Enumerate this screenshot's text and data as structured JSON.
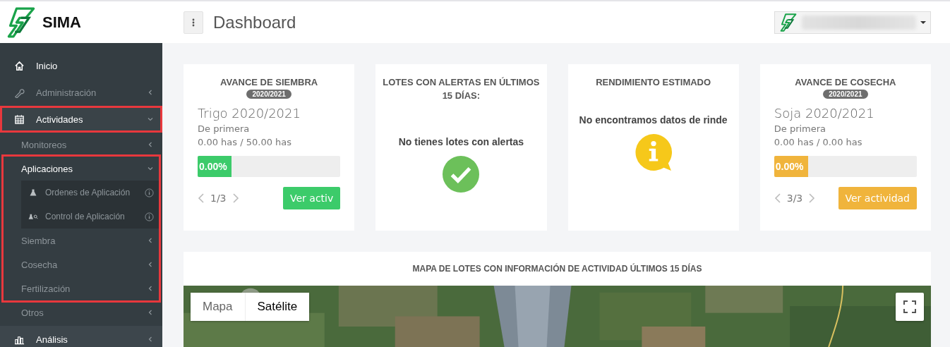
{
  "brand": {
    "name": "SIMA"
  },
  "header": {
    "title": "Dashboard"
  },
  "sidebar": {
    "items": [
      {
        "label": "Inicio",
        "kind": "link",
        "disabled": false,
        "highlighted": false
      },
      {
        "label": "Administración",
        "kind": "menu",
        "disabled": true,
        "expanded": false,
        "highlighted": false
      },
      {
        "label": "Actividades",
        "kind": "menu",
        "disabled": false,
        "expanded": true,
        "highlighted": true,
        "children": [
          {
            "label": "Monitoreos",
            "expanded": false,
            "highlighted": false
          },
          {
            "label": "Aplicaciones",
            "expanded": true,
            "highlighted": true,
            "children": [
              {
                "label": "Ordenes de Aplicación"
              },
              {
                "label": "Control de Aplicación"
              }
            ]
          },
          {
            "label": "Siembra",
            "expanded": false,
            "highlighted": true
          },
          {
            "label": "Cosecha",
            "expanded": false,
            "highlighted": true
          },
          {
            "label": "Fertilización",
            "expanded": false,
            "highlighted": true
          },
          {
            "label": "Otros",
            "expanded": false,
            "highlighted": false
          }
        ]
      },
      {
        "label": "Análisis",
        "kind": "menu",
        "disabled": false,
        "expanded": false,
        "highlighted": false
      }
    ]
  },
  "cards": [
    {
      "kind": "progress",
      "title": "AVANCE DE SIEMBRA",
      "badge": "2020/2021",
      "crop": "Trigo 2020/2021",
      "subtitle": "De primera",
      "area": "0.00 has / 50.00 has",
      "level": 0,
      "percent": "0.00%",
      "color": "#3ccb6a",
      "pager": "1/3",
      "button": "Ver activ"
    },
    {
      "kind": "success",
      "title": "LOTES CON ALERTAS EN ÚLTIMOS 15 DÍAS:",
      "message": "No tienes lotes con alertas"
    },
    {
      "kind": "info",
      "title": "RENDIMIENTO ESTIMADO",
      "message": "No encontramos datos de rinde"
    },
    {
      "kind": "progress",
      "title": "AVANCE DE COSECHA",
      "badge": "2020/2021",
      "crop": "Soja 2020/2021",
      "subtitle": "De primera",
      "area": "0.00 has / 0.00 has",
      "level": 0,
      "percent": "0.00%",
      "color": "#f0b43c",
      "pager": "3/3",
      "button": "Ver actividad"
    }
  ],
  "map": {
    "title": "MAPA DE LOTES CON INFORMACIÓN DE ACTIVIDAD ÚLTIMOS 15 DÍAS",
    "kind": "picture",
    "map_types": [
      {
        "label": "Mapa",
        "selected": false
      },
      {
        "label": "Satélite",
        "selected": true
      }
    ]
  }
}
